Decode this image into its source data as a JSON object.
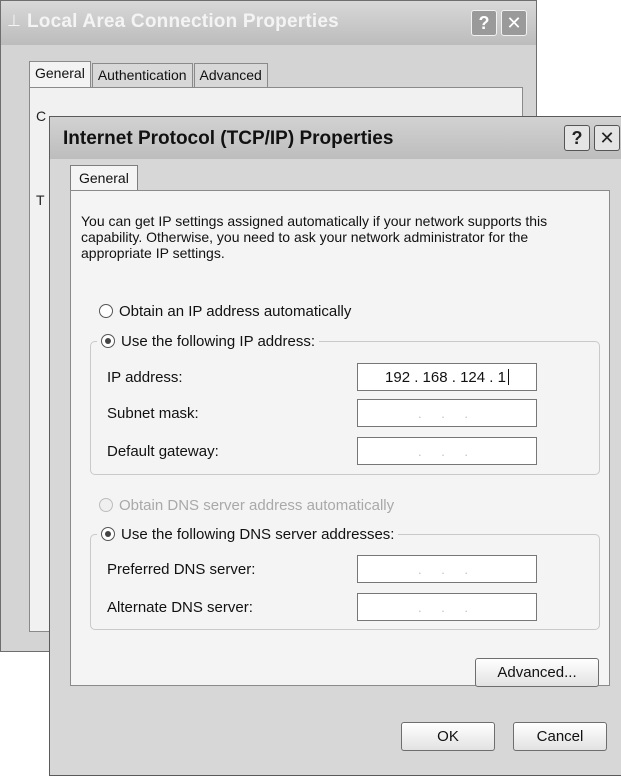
{
  "back_window": {
    "title": "Local Area Connection Properties",
    "title_icon": "network-connection-icon",
    "help_button": "?",
    "close_button": "✕",
    "tabs": [
      {
        "label": "General",
        "active": true
      },
      {
        "label": "Authentication",
        "active": false
      },
      {
        "label": "Advanced",
        "active": false
      }
    ],
    "visible_fragments": [
      "C",
      "T"
    ]
  },
  "front_window": {
    "title": "Internet Protocol (TCP/IP) Properties",
    "help_button": "?",
    "close_button": "✕",
    "tab": "General",
    "intro_text": "You can get IP settings assigned automatically if your network supports this capability. Otherwise, you need to ask your network administrator for the appropriate IP settings.",
    "ip_options": {
      "auto": {
        "label": "Obtain an IP address automatically",
        "selected": false
      },
      "manual": {
        "label": "Use the following IP address:",
        "selected": true
      }
    },
    "ip_fields": [
      {
        "label": "IP address:",
        "value": "192 . 168 . 124 .   1"
      },
      {
        "label": "Subnet mask:",
        "value": ". . ."
      },
      {
        "label": "Default gateway:",
        "value": ". . ."
      }
    ],
    "dns_options": {
      "auto": {
        "label": "Obtain DNS server address automatically",
        "selected": false,
        "disabled": true
      },
      "manual": {
        "label": "Use the following DNS server addresses:",
        "selected": true
      }
    },
    "dns_fields": [
      {
        "label": "Preferred DNS server:",
        "value": ". . ."
      },
      {
        "label": "Alternate DNS server:",
        "value": ". . ."
      }
    ],
    "advanced_button": "Advanced...",
    "ok_button": "OK",
    "cancel_button": "Cancel"
  }
}
